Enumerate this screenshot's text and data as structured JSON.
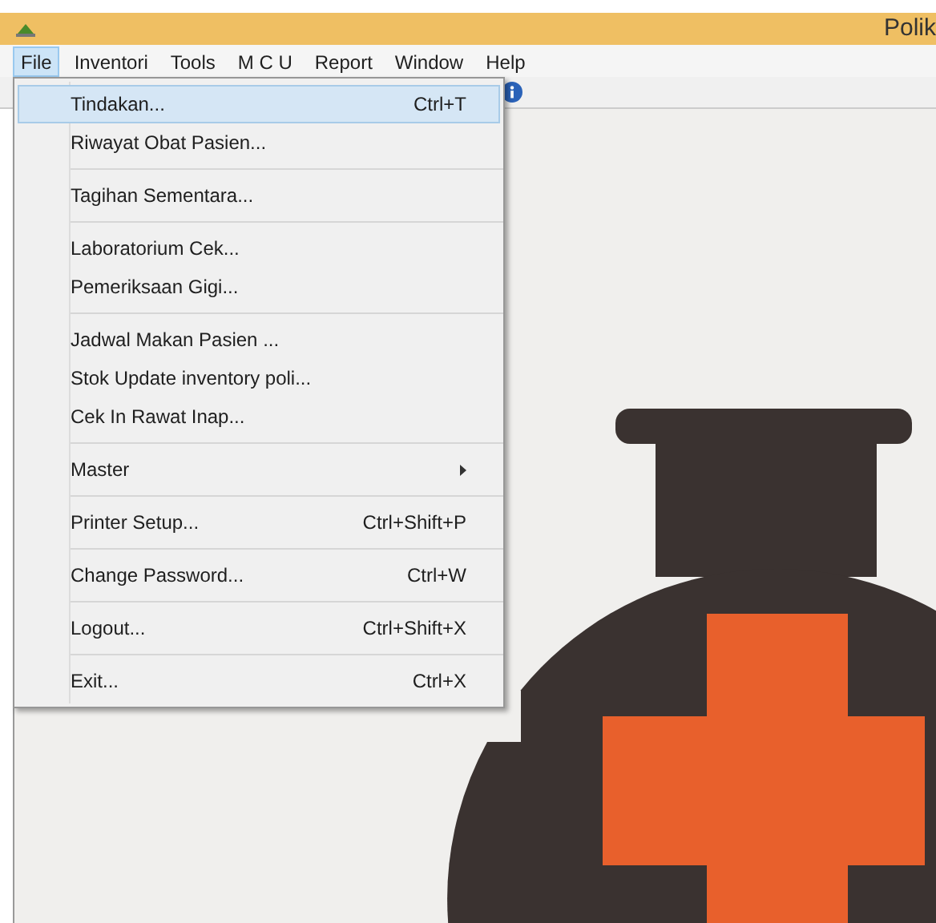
{
  "window": {
    "title": "Polik"
  },
  "menu_bar": [
    {
      "label": "File",
      "selected": true
    },
    {
      "label": "Inventori",
      "selected": false
    },
    {
      "label": "Tools",
      "selected": false
    },
    {
      "label": "M C U",
      "selected": false
    },
    {
      "label": "Report",
      "selected": false
    },
    {
      "label": "Window",
      "selected": false
    },
    {
      "label": "Help",
      "selected": false
    }
  ],
  "file_menu": [
    [
      {
        "label": "Tindakan...",
        "shortcut": "Ctrl+T",
        "kind": "command",
        "selected": true
      },
      {
        "label": "Riwayat Obat Pasien...",
        "kind": "command",
        "selected": false
      }
    ],
    [
      {
        "label": "Tagihan Sementara...",
        "kind": "command",
        "selected": false
      }
    ],
    [
      {
        "label": "Laboratorium Cek...",
        "kind": "command",
        "selected": false
      },
      {
        "label": "Pemeriksaan Gigi...",
        "kind": "command",
        "selected": false
      }
    ],
    [
      {
        "label": "Jadwal Makan Pasien ...",
        "kind": "command",
        "selected": false
      },
      {
        "label": "Stok Update inventory poli...",
        "kind": "command",
        "selected": false
      },
      {
        "label": "Cek In Rawat Inap...",
        "kind": "command",
        "selected": false
      }
    ],
    [
      {
        "label": "Master",
        "kind": "submenu",
        "selected": false
      }
    ],
    [
      {
        "label": "Printer Setup...",
        "shortcut": "Ctrl+Shift+P",
        "kind": "command",
        "selected": false
      }
    ],
    [
      {
        "label": "Change Password...",
        "shortcut": "Ctrl+W",
        "kind": "command",
        "selected": false
      }
    ],
    [
      {
        "label": "Logout...",
        "shortcut": "Ctrl+Shift+X",
        "kind": "command",
        "selected": false
      }
    ],
    [
      {
        "label": "Exit...",
        "shortcut": "Ctrl+X",
        "kind": "command",
        "selected": false
      }
    ]
  ]
}
